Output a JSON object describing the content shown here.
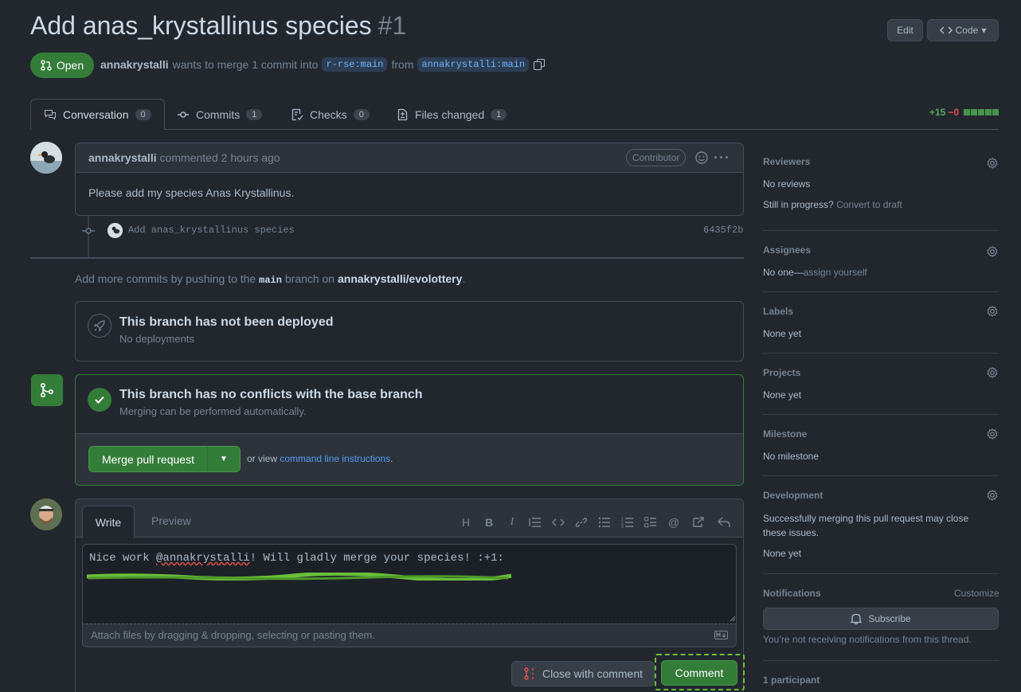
{
  "pr": {
    "title": "Add anas_krystallinus species",
    "number": "#1",
    "state": "Open",
    "author": "annakrystalli",
    "merge_text": "wants to merge 1 commit into",
    "base_branch": "r-rse:main",
    "from_text": "from",
    "head_branch": "annakrystalli:main",
    "edit_label": "Edit",
    "code_label": "Code"
  },
  "tabs": [
    {
      "label": "Conversation",
      "count": "0"
    },
    {
      "label": "Commits",
      "count": "1"
    },
    {
      "label": "Checks",
      "count": "0"
    },
    {
      "label": "Files changed",
      "count": "1"
    }
  ],
  "diffstat": {
    "added": "+15",
    "removed": "−0"
  },
  "comment": {
    "author": "annakrystalli",
    "meta": "commented 2 hours ago",
    "badge": "Contributor",
    "body": "Please add my species Anas Krystallinus."
  },
  "commit": {
    "message": "Add anas_krystallinus species",
    "sha": "6435f2b"
  },
  "push_hint": {
    "prefix": "Add more commits by pushing to the",
    "branch": "main",
    "middle": "branch on",
    "repo": "annakrystalli/evolottery",
    "suffix": "."
  },
  "deploy": {
    "title": "This branch has not been deployed",
    "sub": "No deployments"
  },
  "merge": {
    "title": "This branch has no conflicts with the base branch",
    "sub": "Merging can be performed automatically.",
    "button": "Merge pull request",
    "or_view": "or view",
    "cli_link": "command line instructions",
    "period": "."
  },
  "editor": {
    "tab_write": "Write",
    "tab_preview": "Preview",
    "text_prefix": "Nice work ",
    "mention": "@annakrystalli",
    "text_suffix": "! Will gladly merge your species! :+1:",
    "attach": "Attach files by dragging & dropping, selecting or pasting them.",
    "close_btn": "Close with comment",
    "comment_btn": "Comment"
  },
  "sidebar": {
    "reviewers": {
      "heading": "Reviewers",
      "value": "No reviews",
      "progress": "Still in progress?",
      "draft": "Convert to draft"
    },
    "assignees": {
      "heading": "Assignees",
      "value": "No one—",
      "assign": "assign yourself"
    },
    "labels": {
      "heading": "Labels",
      "value": "None yet"
    },
    "projects": {
      "heading": "Projects",
      "value": "None yet"
    },
    "milestone": {
      "heading": "Milestone",
      "value": "No milestone"
    },
    "development": {
      "heading": "Development",
      "desc": "Successfully merging this pull request may close these issues.",
      "value": "None yet"
    },
    "notifications": {
      "heading": "Notifications",
      "customize": "Customize",
      "subscribe": "Subscribe",
      "note": "You’re not receiving notifications from this thread."
    },
    "participants": {
      "heading": "1 participant"
    }
  },
  "colors": {
    "accent_green": "#347d39",
    "link_blue": "#539bf5",
    "bg": "#22272e"
  }
}
